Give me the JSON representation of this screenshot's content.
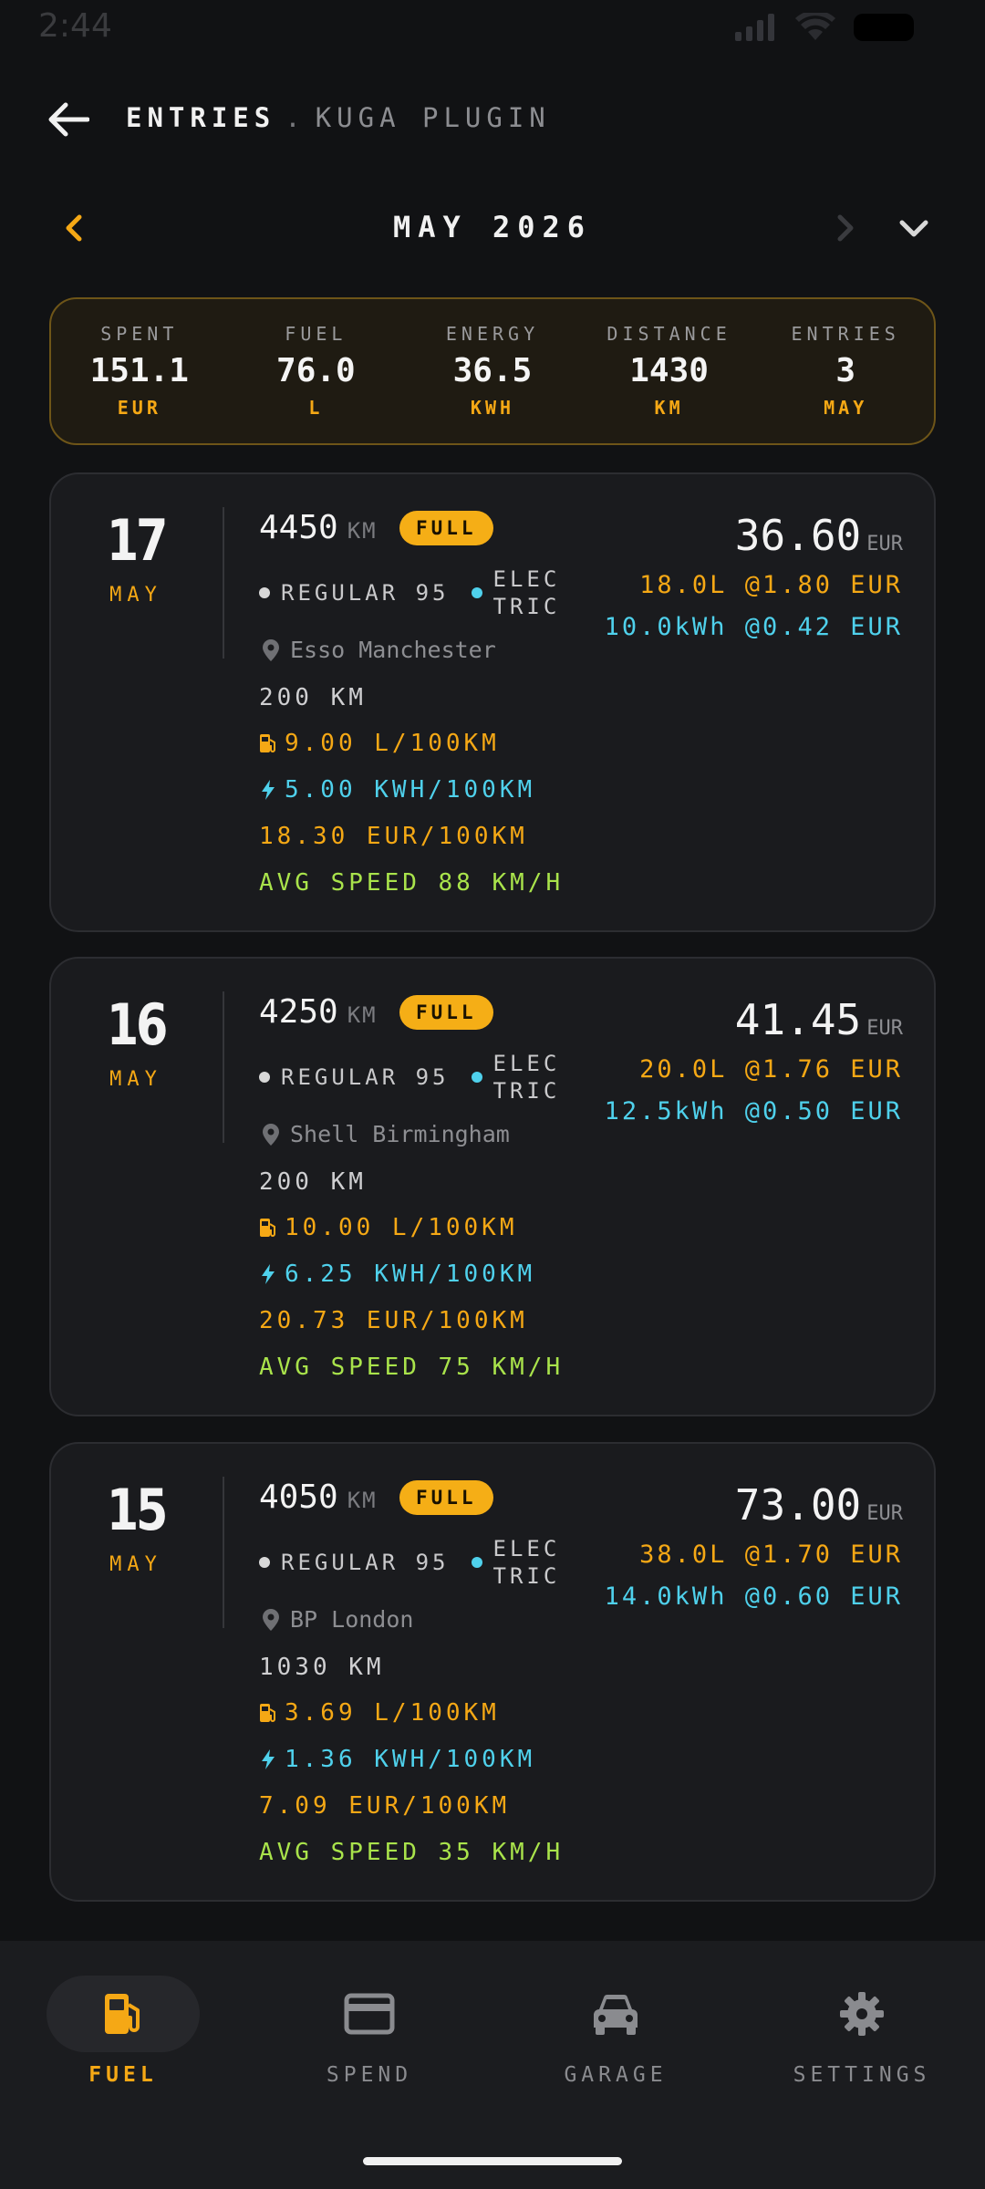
{
  "status": {
    "time": "2:44"
  },
  "header": {
    "title": "ENTRIES",
    "separator": ".",
    "subtitle": "KUGA PLUGIN"
  },
  "month": {
    "label": "MAY 2026"
  },
  "summary": [
    {
      "label": "SPENT",
      "value": "151.1",
      "unit": "EUR"
    },
    {
      "label": "FUEL",
      "value": "76.0",
      "unit": "L"
    },
    {
      "label": "ENERGY",
      "value": "36.5",
      "unit": "KWH"
    },
    {
      "label": "DISTANCE",
      "value": "1430",
      "unit": "KM"
    },
    {
      "label": "ENTRIES",
      "value": "3",
      "unit": "MAY"
    }
  ],
  "entries": [
    {
      "day": "17",
      "month": "MAY",
      "odometer": "4450",
      "odometer_unit": "KM",
      "badge": "FULL",
      "fuel_type": "REGULAR 95",
      "energy_type": "ELECTRIC",
      "station": "Esso Manchester",
      "distance": "200 KM",
      "fuel_consumption": "9.00 L/100KM",
      "energy_consumption": "5.00 KWH/100KM",
      "cost_per_distance": "18.30 EUR/100KM",
      "avg_speed": "AVG SPEED 88 KM/H",
      "price": "36.60",
      "currency": "EUR",
      "fuel_detail": "18.0L @1.80 EUR",
      "energy_detail": "10.0kWh @0.42 EUR"
    },
    {
      "day": "16",
      "month": "MAY",
      "odometer": "4250",
      "odometer_unit": "KM",
      "badge": "FULL",
      "fuel_type": "REGULAR 95",
      "energy_type": "ELECTRIC",
      "station": "Shell Birmingham",
      "distance": "200 KM",
      "fuel_consumption": "10.00 L/100KM",
      "energy_consumption": "6.25 KWH/100KM",
      "cost_per_distance": "20.73 EUR/100KM",
      "avg_speed": "AVG SPEED 75 KM/H",
      "price": "41.45",
      "currency": "EUR",
      "fuel_detail": "20.0L @1.76 EUR",
      "energy_detail": "12.5kWh @0.50 EUR"
    },
    {
      "day": "15",
      "month": "MAY",
      "odometer": "4050",
      "odometer_unit": "KM",
      "badge": "FULL",
      "fuel_type": "REGULAR 95",
      "energy_type": "ELECTRIC",
      "station": "BP London",
      "distance": "1030 KM",
      "fuel_consumption": "3.69 L/100KM",
      "energy_consumption": "1.36 KWH/100KM",
      "cost_per_distance": "7.09 EUR/100KM",
      "avg_speed": "AVG SPEED 35 KM/H",
      "price": "73.00",
      "currency": "EUR",
      "fuel_detail": "38.0L @1.70 EUR",
      "energy_detail": "14.0kWh @0.60 EUR"
    }
  ],
  "nav": [
    {
      "label": "FUEL",
      "icon": "fuel-pump-icon",
      "active": true
    },
    {
      "label": "SPEND",
      "icon": "credit-card-icon",
      "active": false
    },
    {
      "label": "GARAGE",
      "icon": "car-icon",
      "active": false
    },
    {
      "label": "SETTINGS",
      "icon": "gear-icon",
      "active": false
    }
  ],
  "colors": {
    "accent": "#f5a815",
    "electric": "#4fd1ec",
    "speed": "#a9e34b",
    "fuel_dot": "#d8d8d8"
  }
}
